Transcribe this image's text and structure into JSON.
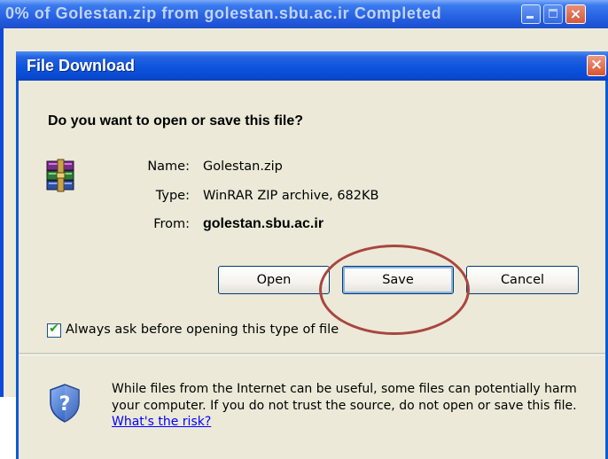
{
  "background_window": {
    "title": "0% of Golestan.zip from golestan.sbu.ac.ir Completed",
    "minimize": "minimize",
    "maximize": "maximize",
    "close": "×"
  },
  "dialog": {
    "title": "File Download",
    "close": "×",
    "question": "Do you want to open or save this file?",
    "file": {
      "icon": "winrar-archive-icon",
      "name_label": "Name:",
      "name": "Golestan.zip",
      "type_label": "Type:",
      "type": "WinRAR ZIP archive, 682KB",
      "from_label": "From:",
      "from": "golestan.sbu.ac.ir"
    },
    "buttons": {
      "open": "Open",
      "save": "Save",
      "cancel": "Cancel"
    },
    "always_ask": {
      "checked": true,
      "label": "Always ask before opening this type of file"
    },
    "warning": {
      "icon": "shield-question-icon",
      "text": "While files from the Internet can be useful, some files can potentially harm your computer. If you do not trust the source, do not open or save this file.",
      "link": "What's the risk?"
    }
  },
  "colors": {
    "titlebar": "#0a4ad2",
    "dialog_bg": "#ece9d8",
    "annotation": "#a8463f",
    "link": "#0000ff"
  }
}
